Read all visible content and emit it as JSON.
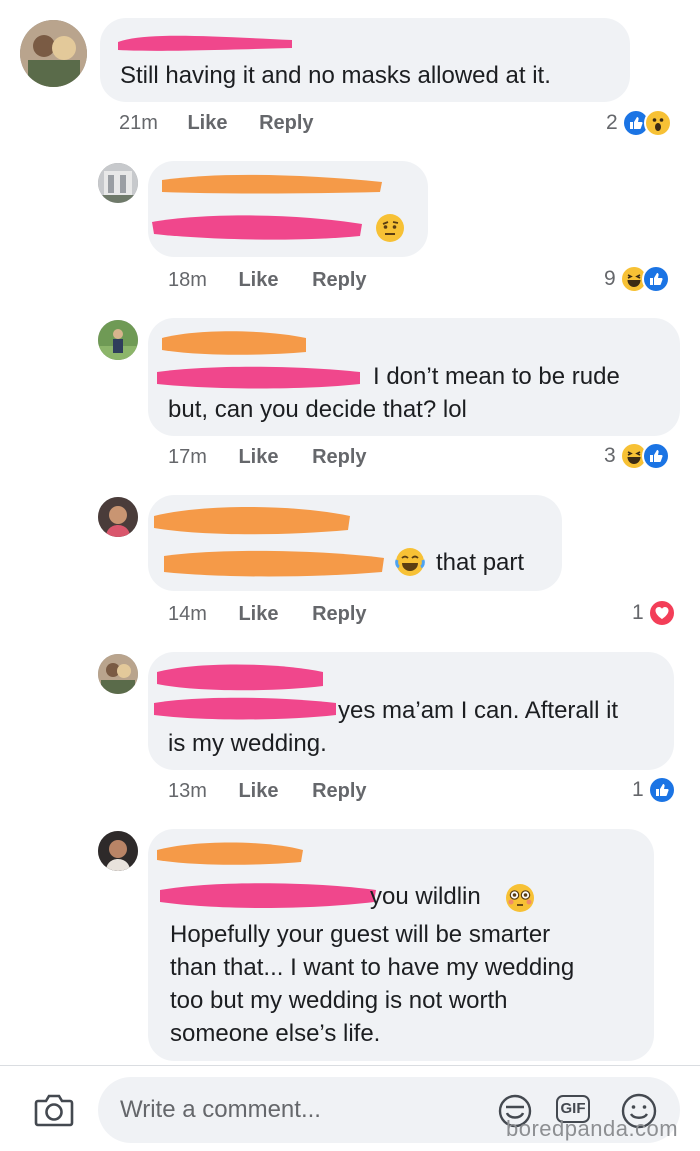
{
  "comments": [
    {
      "text_lines": [
        "Still having it and no masks allowed at it."
      ],
      "time": "21m",
      "like_label": "Like",
      "reply_label": "Reply",
      "reaction_count": "2",
      "reactions": [
        "like",
        "wow"
      ]
    },
    {
      "text_lines": [],
      "time": "18m",
      "like_label": "Like",
      "reply_label": "Reply",
      "reaction_count": "9",
      "reactions": [
        "haha",
        "like"
      ]
    },
    {
      "text_lines": [
        "I don’t mean to be rude",
        "but, can you decide that? lol"
      ],
      "time": "17m",
      "like_label": "Like",
      "reply_label": "Reply",
      "reaction_count": "3",
      "reactions": [
        "haha",
        "like"
      ]
    },
    {
      "text_lines": [
        "that part"
      ],
      "time": "14m",
      "like_label": "Like",
      "reply_label": "Reply",
      "reaction_count": "1",
      "reactions": [
        "love"
      ]
    },
    {
      "text_lines": [
        "yes ma’am I can. Afterall it",
        "is my wedding."
      ],
      "time": "13m",
      "like_label": "Like",
      "reply_label": "Reply",
      "reaction_count": "1",
      "reactions": [
        "like"
      ]
    },
    {
      "text_lines": [
        "you wildlin",
        "Hopefully your guest will be smarter",
        "than that... I want to have my wedding",
        "too but my wedding is not worth",
        "someone else’s life."
      ]
    }
  ],
  "composer": {
    "placeholder": "Write a comment...",
    "gif_label": "GIF"
  },
  "watermark": "boredpanda.com",
  "colors": {
    "pink_redaction": "#f0478c",
    "orange_redaction": "#f59a48",
    "like_blue": "#1b74e4",
    "love_red": "#f33e58",
    "emoji_yellow": "#f7c135",
    "bubble_gray": "#f0f2f5"
  }
}
